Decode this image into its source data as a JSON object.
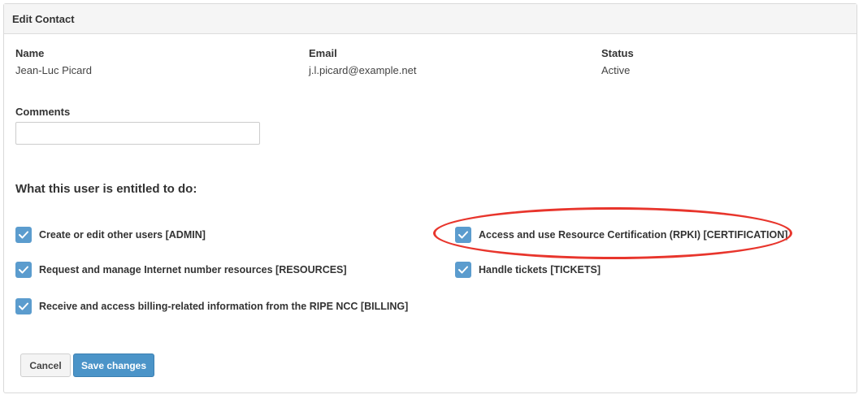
{
  "panel": {
    "title": "Edit Contact"
  },
  "contact": {
    "name_label": "Name",
    "name_value": "Jean-Luc Picard",
    "email_label": "Email",
    "email_value": "j.l.picard@example.net",
    "status_label": "Status",
    "status_value": "Active"
  },
  "comments": {
    "label": "Comments",
    "value": ""
  },
  "permissions": {
    "title": "What this user is entitled to do:",
    "items": [
      {
        "label": "Create or edit other users [ADMIN]",
        "checked": true
      },
      {
        "label": "Access and use Resource Certification (RPKI) [CERTIFICATION]",
        "checked": true
      },
      {
        "label": "Request and manage Internet number resources [RESOURCES]",
        "checked": true
      },
      {
        "label": "Handle tickets [TICKETS]",
        "checked": true
      },
      {
        "label": "Receive and access billing-related information from the RIPE NCC [BILLING]",
        "checked": true
      }
    ]
  },
  "annotation": {
    "color": "#e8352c"
  },
  "actions": {
    "cancel_label": "Cancel",
    "save_label": "Save changes"
  },
  "colors": {
    "checkbox": "#5b9cce",
    "primary_button": "#4b94c8"
  }
}
